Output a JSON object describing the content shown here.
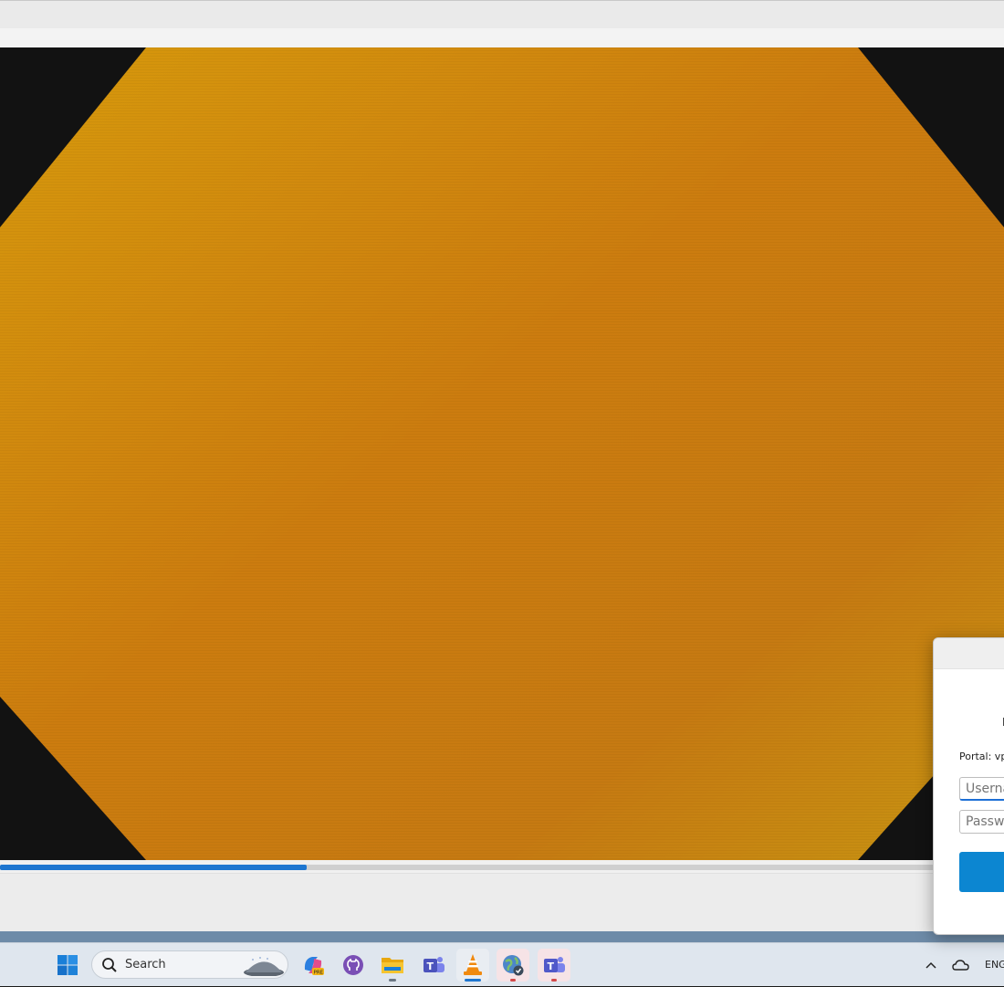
{
  "player": {
    "progress_fraction": 0.305,
    "colors": {
      "video_frame": "#c77a10",
      "seek_fill": "#1e76d0"
    }
  },
  "taskbar": {
    "search_label": "Search",
    "language": "ENG",
    "apps": [
      {
        "name": "copilot-icon"
      },
      {
        "name": "github-desktop-icon"
      },
      {
        "name": "file-explorer-icon"
      },
      {
        "name": "teams-icon"
      },
      {
        "name": "vlc-icon"
      },
      {
        "name": "globalprotect-icon"
      },
      {
        "name": "teams-new-icon"
      }
    ]
  },
  "vpn_dialog": {
    "portal_label": "Portal: vp",
    "username_placeholder": "Username",
    "password_placeholder": "Password",
    "connect_color": "#0c86d1"
  }
}
